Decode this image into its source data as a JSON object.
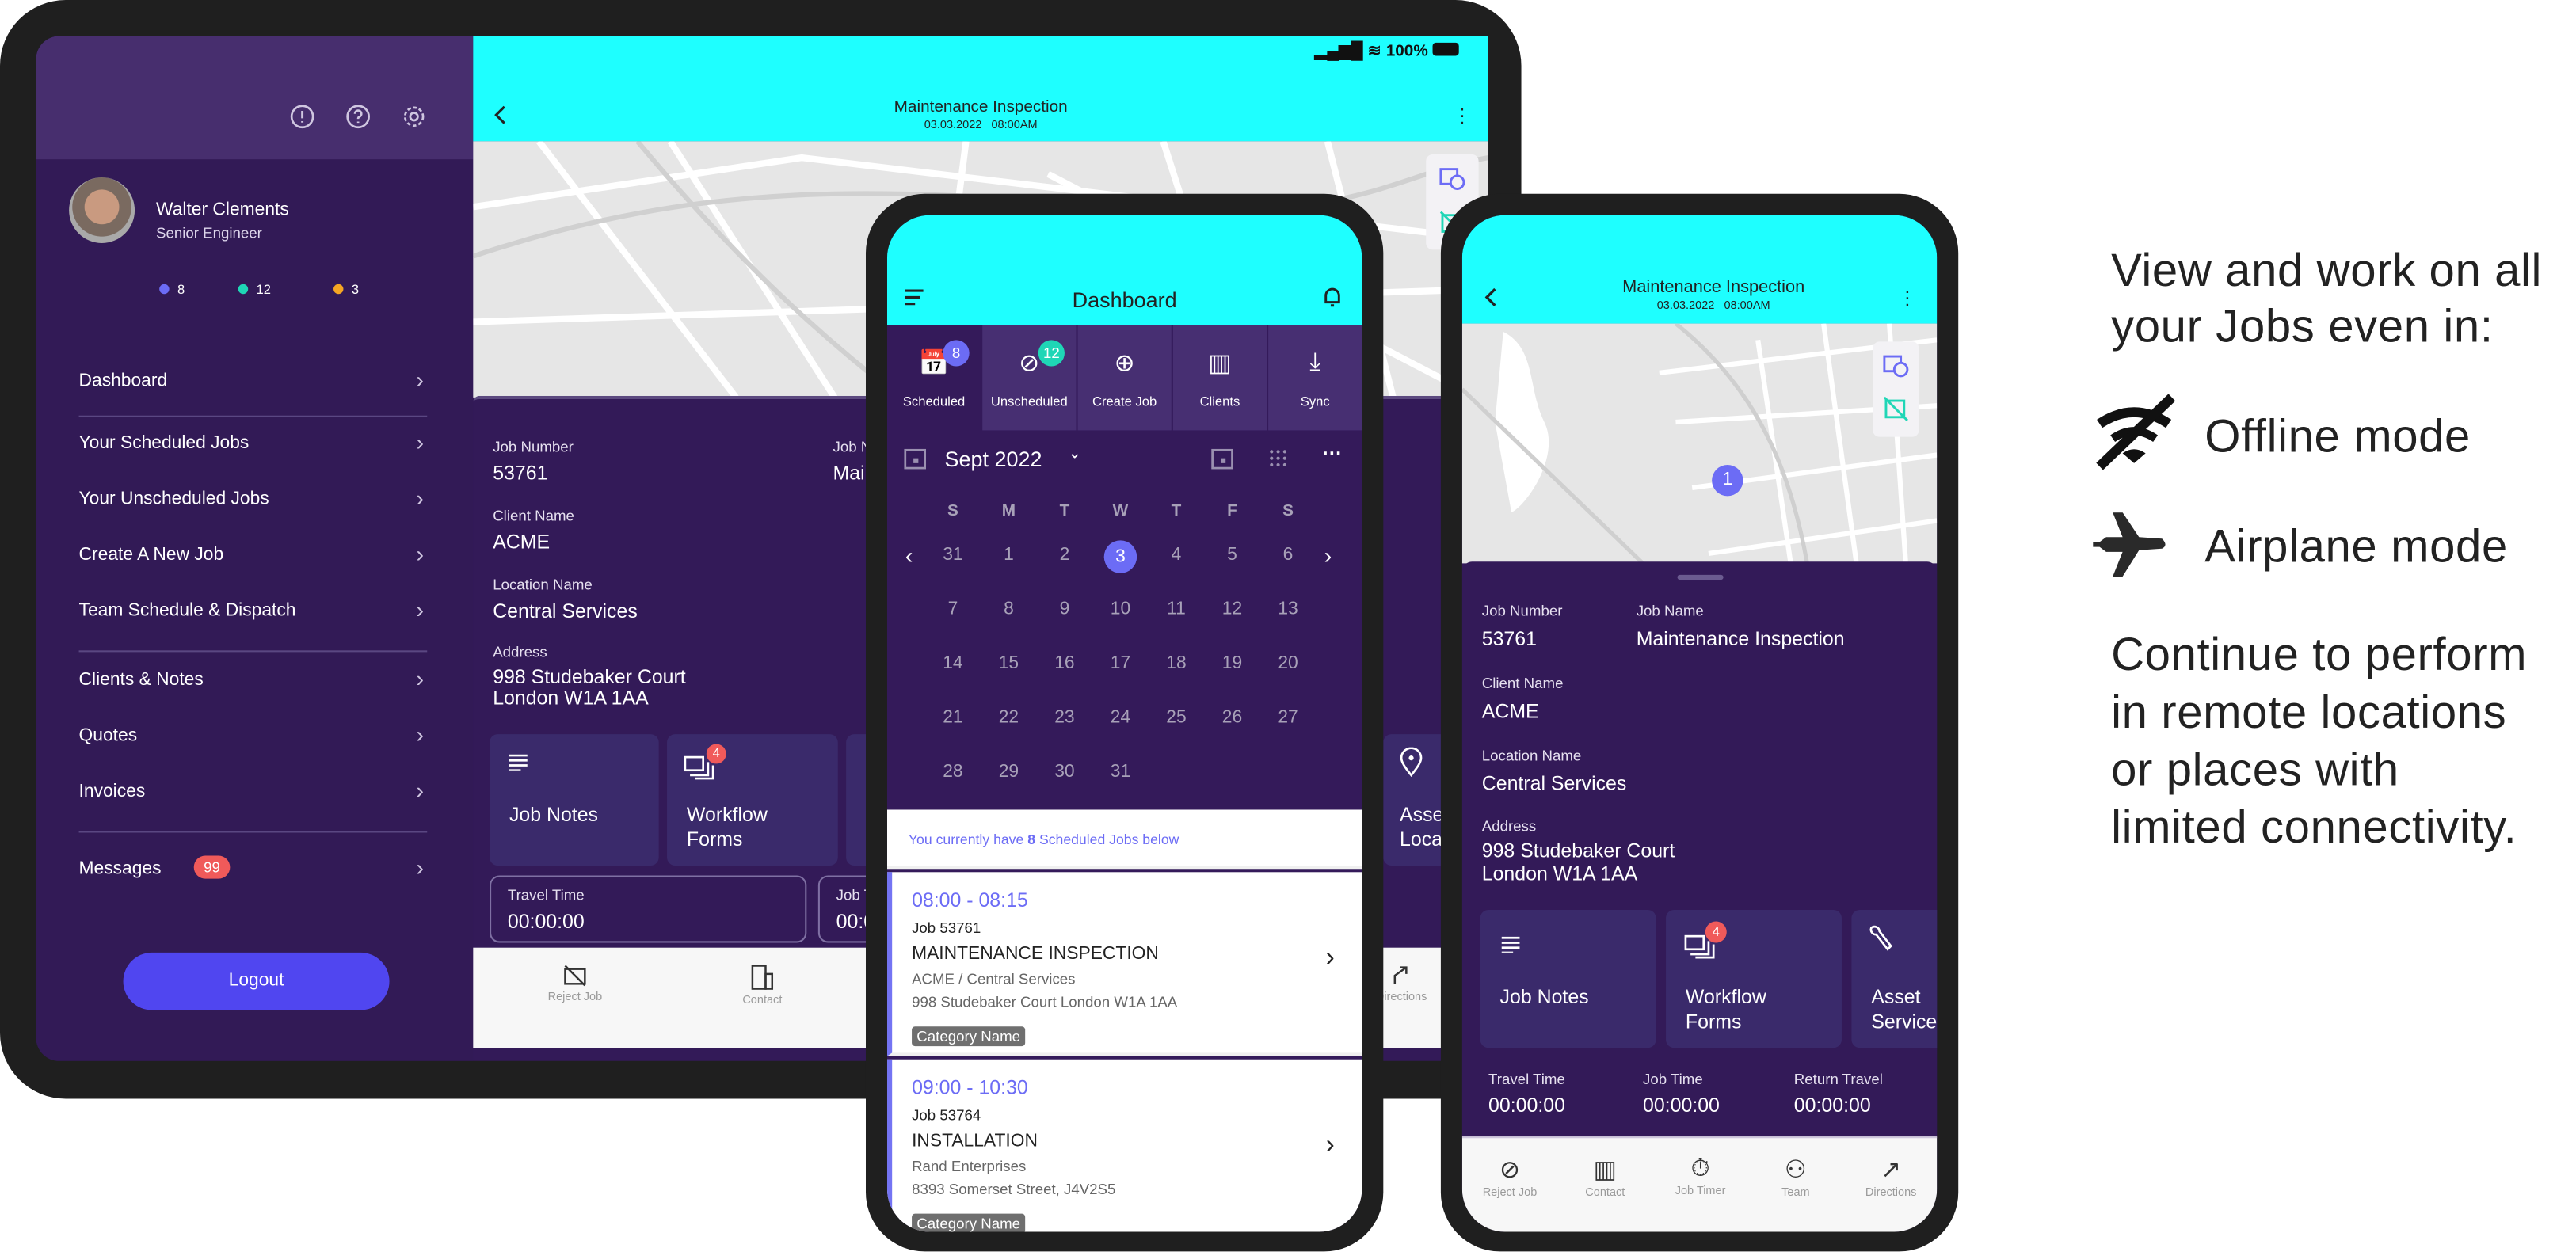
{
  "colors": {
    "header": "#1effff",
    "panel": "#331a58",
    "accent": "#6c6cf5",
    "teal": "#1fd6b6",
    "orange": "#f5a623",
    "badge_red": "#f05a5a",
    "logout": "#5046f0"
  },
  "tablet": {
    "status": {
      "battery": "100%"
    },
    "header": {
      "title": "Maintenance Inspection",
      "subtitle": "03.03.2022   08:00AM"
    },
    "sidebar": {
      "icons": [
        "alert-icon",
        "help-icon",
        "settings-icon"
      ],
      "user": {
        "name": "Walter Clements",
        "role": "Senior Engineer"
      },
      "counts": [
        {
          "value": "8",
          "color": "#6c6cf5"
        },
        {
          "value": "12",
          "color": "#1fd6b6"
        },
        {
          "value": "3",
          "color": "#f5a623"
        }
      ],
      "items": [
        {
          "label": "Dashboard"
        },
        {
          "label": "Your Scheduled Jobs"
        },
        {
          "label": "Your Unscheduled Jobs"
        },
        {
          "label": "Create A New Job"
        },
        {
          "label": "Team Schedule & Dispatch"
        },
        {
          "label": "Clients & Notes"
        },
        {
          "label": "Quotes"
        },
        {
          "label": "Invoices"
        },
        {
          "label": "Messages",
          "badge": "99"
        }
      ],
      "logout": "Logout"
    },
    "job": {
      "job_number_label": "Job Number",
      "job_number": "53761",
      "job_name_label": "Job Name",
      "job_name": "Maintenance Inspection",
      "client_label": "Client Name",
      "client": "ACME",
      "location_label": "Location Name",
      "location": "Central Services",
      "address_label": "Address",
      "address_1": "998 Studebaker Court",
      "address_2": "London W1A 1AA"
    },
    "tiles": [
      {
        "label": "Job Notes"
      },
      {
        "label": "Workflow Forms",
        "badge": "4"
      },
      {
        "label": "Asset Location"
      }
    ],
    "timers": [
      {
        "label": "Travel Time",
        "value": "00:00:00"
      },
      {
        "label": "Job Time",
        "value": "00:00:00"
      }
    ],
    "nav": [
      {
        "label": "Reject Job"
      },
      {
        "label": "Contact"
      },
      {
        "label": "Directions"
      }
    ]
  },
  "phone_dashboard": {
    "title": "Dashboard",
    "toolbar": [
      {
        "label": "Scheduled",
        "badge": "8"
      },
      {
        "label": "Unscheduled",
        "badge": "12"
      },
      {
        "label": "Create Job"
      },
      {
        "label": "Clients"
      },
      {
        "label": "Sync"
      }
    ],
    "calendar": {
      "month": "Sept 2022",
      "weekdays": [
        "S",
        "M",
        "T",
        "W",
        "T",
        "F",
        "S"
      ],
      "weeks": [
        [
          "31",
          "1",
          "2",
          "3",
          "4",
          "5",
          "6"
        ],
        [
          "7",
          "8",
          "9",
          "10",
          "11",
          "12",
          "13"
        ],
        [
          "14",
          "15",
          "16",
          "17",
          "18",
          "19",
          "20"
        ],
        [
          "21",
          "22",
          "23",
          "24",
          "25",
          "26",
          "27"
        ],
        [
          "28",
          "29",
          "30",
          "31",
          "",
          "",
          ""
        ]
      ],
      "selected": "3"
    },
    "summary": {
      "prefix": "You currently have ",
      "count": "8",
      "suffix": " Scheduled Jobs below"
    },
    "jobs": [
      {
        "time": "08:00 - 08:15",
        "job": "Job 53761",
        "title": "MAINTENANCE INSPECTION",
        "client": "ACME / Central Services",
        "address": "998 Studebaker Court London W1A 1AA",
        "category": "Category Name"
      },
      {
        "time": "09:00 - 10:30",
        "job": "Job 53764",
        "title": "INSTALLATION",
        "client": "Rand Enterprises",
        "address": "8393 Somerset Street, J4V2S5",
        "category": "Category Name"
      }
    ]
  },
  "phone_job": {
    "header": {
      "title": "Maintenance Inspection",
      "subtitle": "03.03.2022   08:00AM"
    },
    "map_pin": "1",
    "job": {
      "job_number_label": "Job Number",
      "job_number": "53761",
      "job_name_label": "Job Name",
      "job_name": "Maintenance Inspection",
      "client_label": "Client Name",
      "client": "ACME",
      "location_label": "Location Name",
      "location": "Central Services",
      "address_label": "Address",
      "address_1": "998 Studebaker Court",
      "address_2": "London W1A 1AA"
    },
    "tiles": [
      {
        "label": "Job Notes"
      },
      {
        "label": "Workflow Forms",
        "badge": "4"
      },
      {
        "label": "Asset Service"
      }
    ],
    "timers": [
      {
        "label": "Travel Time",
        "value": "00:00:00"
      },
      {
        "label": "Job Time",
        "value": "00:00:00"
      },
      {
        "label": "Return Travel",
        "value": "00:00:00"
      }
    ],
    "nav": [
      {
        "label": "Reject Job"
      },
      {
        "label": "Contact"
      },
      {
        "label": "Job Timer"
      },
      {
        "label": "Team"
      },
      {
        "label": "Directions"
      }
    ]
  },
  "marketing": {
    "intro_1": "View and work on all",
    "intro_2": "your Jobs even in:",
    "modes": [
      {
        "label": "Offline mode",
        "icon": "wifi-off-icon"
      },
      {
        "label": "Airplane mode",
        "icon": "airplane-icon"
      }
    ],
    "outro": [
      "Continue to perform",
      "in remote locations",
      "or places with",
      "limited connectivity."
    ]
  }
}
